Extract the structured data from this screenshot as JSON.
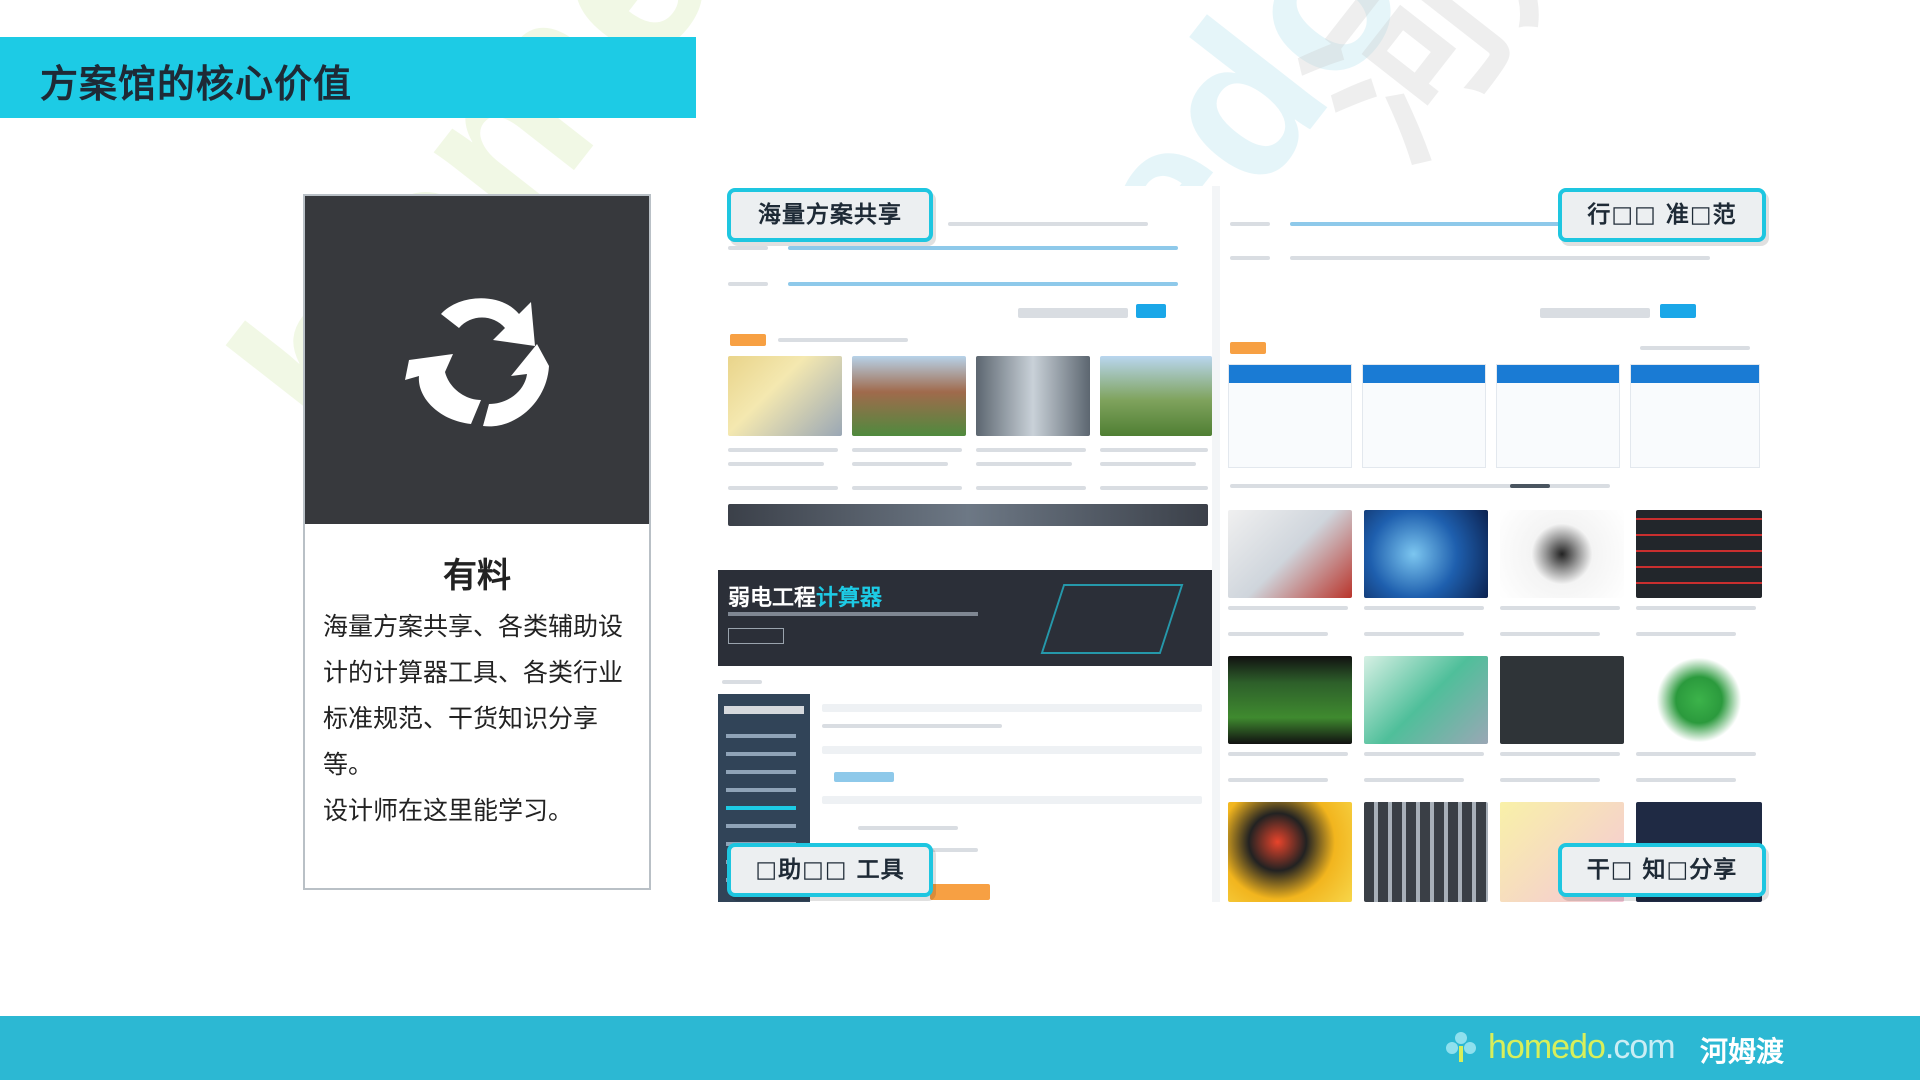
{
  "header": {
    "title": "方案馆的核心价值"
  },
  "card": {
    "heading": "有料",
    "body_lines": [
      "海量方案共享、各类辅助设",
      "计的计算器工具、各类行业",
      "标准规范、干货知识分享",
      "等。",
      "设计师在这里能学习。"
    ]
  },
  "collage": {
    "banner_title": "弱电工程",
    "banner_title_accent": "计算器"
  },
  "callouts": {
    "share": "海量方案共享",
    "standards": "行□□ 准□范",
    "tools": "□助□□ 工具",
    "knowledge": "干□ 知□分享"
  },
  "footer": {
    "logo_en_primary": "homedo",
    "logo_en_suffix": ".com",
    "logo_cn": "河姆渡"
  },
  "watermark": {
    "text_1": "homedo.com",
    "text_2": "homedo.com",
    "text_3": "河姆渡"
  },
  "colors": {
    "accent": "#1dcbe5",
    "footer": "#2cb8d3",
    "card_dark": "#37393d",
    "logo_green": "#d8ef5a"
  }
}
